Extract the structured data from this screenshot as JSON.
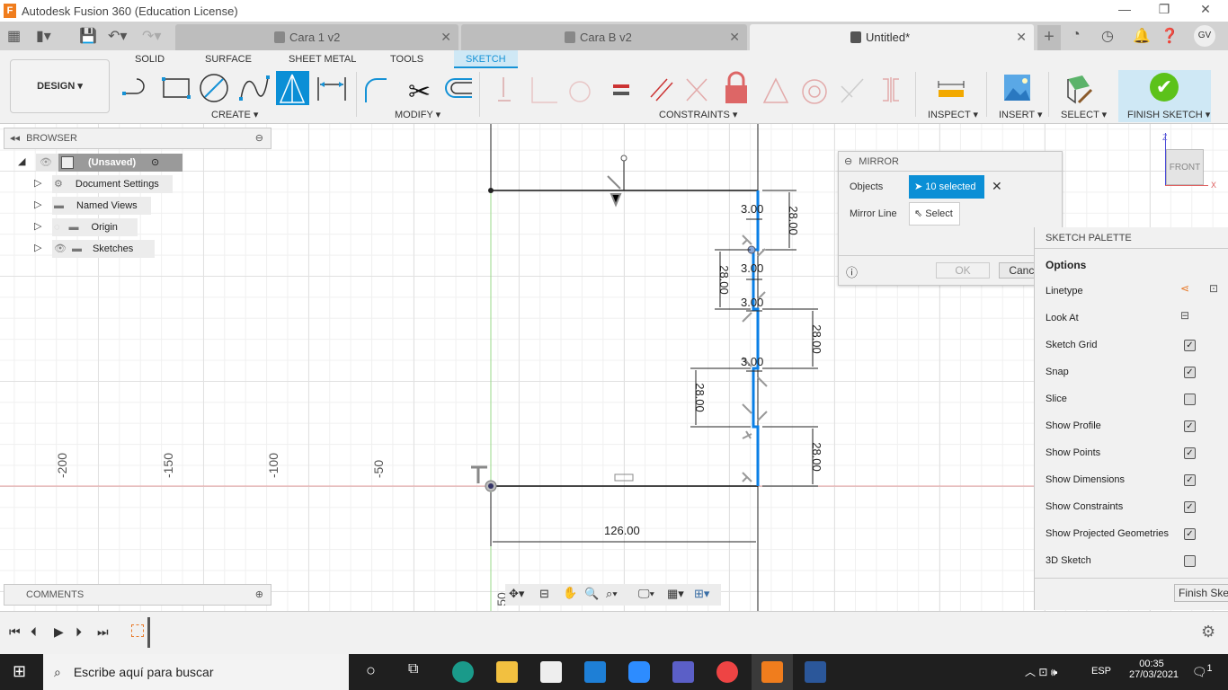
{
  "window": {
    "title": "Autodesk Fusion 360 (Education License)",
    "logo": "F",
    "minimize": "—",
    "restore": "❐",
    "close": "✕"
  },
  "tabs": [
    {
      "label": "Cara 1 v2",
      "active": false
    },
    {
      "label": "Cara B v2",
      "active": false
    },
    {
      "label": "Untitled*",
      "active": true
    }
  ],
  "user": {
    "initials": "GV"
  },
  "ribbon": {
    "workspace": "DESIGN ▾",
    "tabs": [
      "SOLID",
      "SURFACE",
      "SHEET METAL",
      "TOOLS",
      "SKETCH"
    ],
    "active_tab": "SKETCH",
    "groups": {
      "create": "CREATE ▾",
      "modify": "MODIFY ▾",
      "constraints": "CONSTRAINTS ▾",
      "inspect": "INSPECT ▾",
      "insert": "INSERT ▾",
      "select": "SELECT ▾",
      "finish": "FINISH SKETCH ▾"
    }
  },
  "browser": {
    "title": "BROWSER",
    "root": "(Unsaved)",
    "items": [
      "Document Settings",
      "Named Views",
      "Origin",
      "Sketches"
    ]
  },
  "comments": {
    "title": "COMMENTS"
  },
  "mirror": {
    "title": "MIRROR",
    "objects_label": "Objects",
    "objects_value": "10 selected",
    "mirror_line_label": "Mirror Line",
    "mirror_line_value": "Select",
    "ok": "OK",
    "cancel": "Cancel"
  },
  "viewcube": {
    "face": "FRONT",
    "z": "Z",
    "x": "X"
  },
  "palette": {
    "title": "SKETCH PALETTE",
    "section": "Options",
    "linetype": "Linetype",
    "look_at": "Look At",
    "options": [
      {
        "label": "Sketch Grid",
        "checked": true
      },
      {
        "label": "Snap",
        "checked": true
      },
      {
        "label": "Slice",
        "checked": false
      },
      {
        "label": "Show Profile",
        "checked": true
      },
      {
        "label": "Show Points",
        "checked": true
      },
      {
        "label": "Show Dimensions",
        "checked": true
      },
      {
        "label": "Show Constraints",
        "checked": true
      },
      {
        "label": "Show Projected Geometries",
        "checked": true
      },
      {
        "label": "3D Sketch",
        "checked": false
      }
    ],
    "finish": "Finish Sketch"
  },
  "sketch": {
    "dims": {
      "width": "126.00",
      "h1": "28.00",
      "h2": "28.00",
      "h3": "28.00",
      "h4": "28.00",
      "h5": "28.00",
      "t1": "3.00",
      "t2": "3.00",
      "t3": "3.00",
      "t4": "3.00"
    },
    "ruler": [
      "-200",
      "-150",
      "-100",
      "-50",
      "50"
    ],
    "accent": "#0a7fe6"
  },
  "taskbar": {
    "search": "Escribe aquí para buscar",
    "lang": "ESP",
    "time": "00:35",
    "date": "27/03/2021",
    "notif": "1"
  }
}
